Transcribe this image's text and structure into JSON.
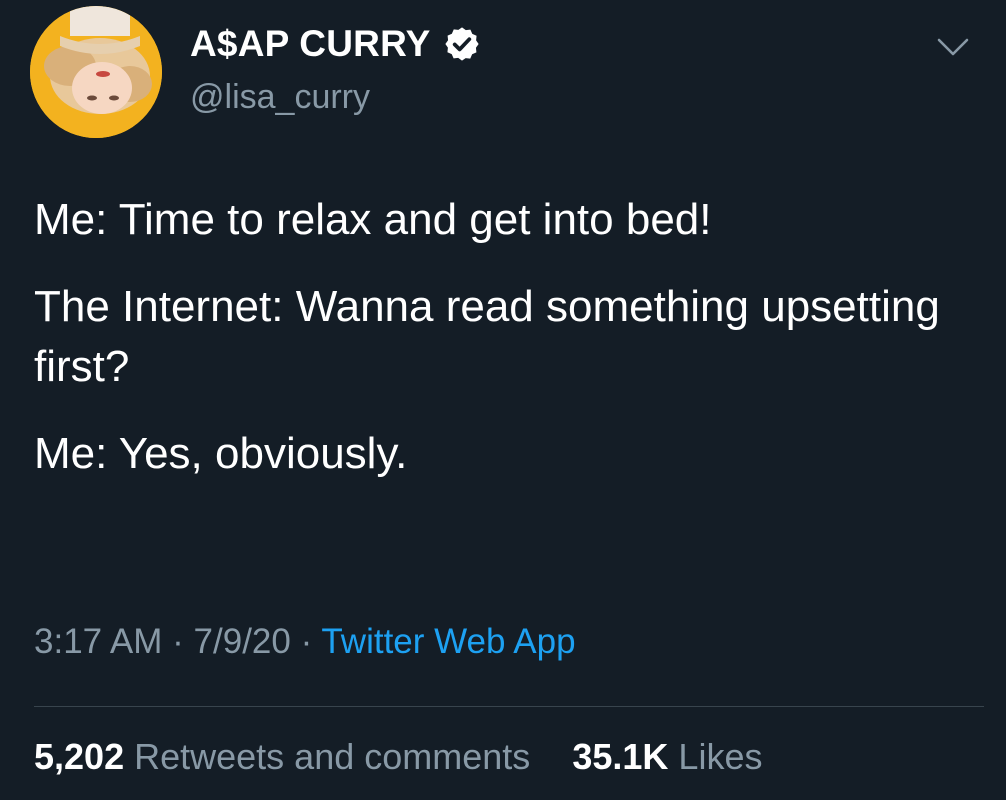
{
  "author": {
    "display_name": "A$AP CURRY",
    "handle": "@lisa_curry",
    "verified": true,
    "avatar_icon": "profile-photo-upside-down-face"
  },
  "tweet": {
    "lines": [
      "Me: Time to relax and get into bed!",
      "The Internet: Wanna read something upsetting first?",
      "Me: Yes, obviously."
    ]
  },
  "meta": {
    "time": "3:17 AM",
    "separator": "·",
    "date": "7/9/20",
    "source": "Twitter Web App"
  },
  "stats": {
    "retweets_count": "5,202",
    "retweets_label": "Retweets and comments",
    "likes_count": "35.1K",
    "likes_label": "Likes"
  },
  "icons": {
    "verified": "verified-badge-icon",
    "menu": "chevron-down-icon"
  },
  "colors": {
    "background": "#141d26",
    "text": "#ffffff",
    "secondary": "#8899a6",
    "link": "#1da1f2",
    "divider": "#38444d"
  }
}
